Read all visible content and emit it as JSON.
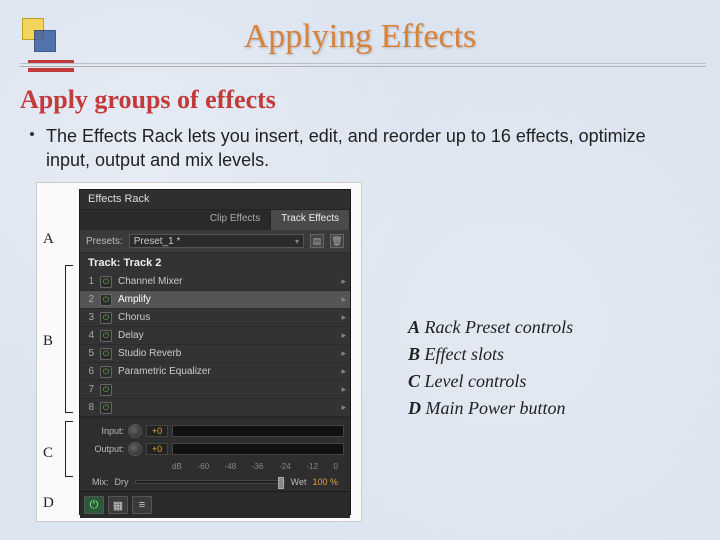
{
  "slide": {
    "title": "Applying Effects",
    "sectionHeading": "Apply groups of effects",
    "bullet": "The Effects Rack lets you insert, edit, and reorder up to 16 effects, optimize input, output and mix levels."
  },
  "callouts": {
    "A": "A",
    "B": "B",
    "C": "C",
    "D": "D"
  },
  "panel": {
    "title": "Effects Rack",
    "tabs": {
      "clip": "Clip Effects",
      "track": "Track Effects"
    },
    "preset": {
      "label": "Presets:",
      "value": "Preset_1 *"
    },
    "trackLabel": "Track: Track 2",
    "slots": [
      {
        "n": "1",
        "name": "Channel Mixer"
      },
      {
        "n": "2",
        "name": "Amplify"
      },
      {
        "n": "3",
        "name": "Chorus"
      },
      {
        "n": "4",
        "name": "Delay"
      },
      {
        "n": "5",
        "name": "Studio Reverb"
      },
      {
        "n": "6",
        "name": "Parametric Equalizer"
      },
      {
        "n": "7",
        "name": ""
      },
      {
        "n": "8",
        "name": ""
      }
    ],
    "input": {
      "label": "Input:",
      "val": "+0"
    },
    "output": {
      "label": "Output:",
      "val": "+0"
    },
    "ruler": [
      "dB",
      "-60",
      "-48",
      "-36",
      "-24",
      "-12",
      "0"
    ],
    "mix": {
      "label": "Mix:",
      "dry": "Dry",
      "wet": "Wet",
      "val": "100 %"
    }
  },
  "legend": {
    "A": {
      "key": "A",
      "text": " Rack Preset controls"
    },
    "B": {
      "key": "B",
      "text": " Effect slots"
    },
    "C": {
      "key": "C",
      "text": " Level controls"
    },
    "D": {
      "key": "D",
      "text": " Main Power button"
    }
  }
}
